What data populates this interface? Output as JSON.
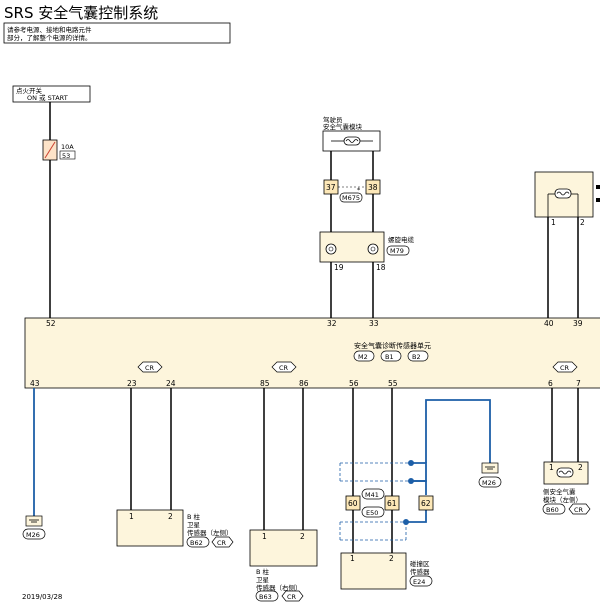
{
  "title": "SRS 安全气囊控制系统",
  "note": {
    "line1": "请参考电源、接地和电路元件",
    "line2": "部分，了解整个电源的详情。"
  },
  "ignition": {
    "line1": "点火开关",
    "line2": "ON 或 START"
  },
  "fuse": {
    "rating": "10A",
    "number": "53"
  },
  "driver_module": {
    "line1": "驾驶员",
    "line2": "安全气囊模块",
    "pin_a": "37",
    "pin_b": "38",
    "connector": "M675",
    "marker": "*"
  },
  "spiral_cable": {
    "label": "螺旋电缆",
    "connector": "M79",
    "pin_a": "19",
    "pin_b": "18"
  },
  "right_module": {
    "pin_a": "1",
    "pin_b": "2"
  },
  "unit": {
    "line1": "安全气囊诊断传感器单元",
    "conn_a": "M2",
    "conn_b": "B1",
    "conn_c": "B2",
    "top_pins": [
      "52",
      "32",
      "33",
      "40",
      "39"
    ],
    "bottom_pins": [
      "43",
      "23",
      "24",
      "85",
      "86",
      "56",
      "55",
      "6",
      "7"
    ],
    "cr_label": "CR"
  },
  "ground_left": "M26",
  "ground_right": "M26",
  "b_pillar_left": {
    "line1": "B 柱",
    "line2": "卫星",
    "line3": "传感器（左侧）",
    "connector": "B62",
    "tag": "CR",
    "pin_a": "1",
    "pin_b": "2"
  },
  "b_pillar_right": {
    "line1": "B 柱",
    "line2": "卫星",
    "line3": "传感器（右侧）",
    "connector": "B63",
    "tag": "CR",
    "pin_a": "1",
    "pin_b": "2"
  },
  "crash_sensor": {
    "line1": "碰撞区",
    "line2": "传感器",
    "connector": "E24",
    "pin_a": "1",
    "pin_b": "2"
  },
  "joint": {
    "pin_a": "60",
    "pin_b": "61",
    "pin_c": "62",
    "conn_a": "M41",
    "conn_b": "E50"
  },
  "side_module": {
    "line1": "侧安全气囊",
    "line2": "模块（左侧）",
    "connector": "B60",
    "tag": "CR",
    "pin_a": "1",
    "pin_b": "2"
  },
  "date": "2019/03/28",
  "colors": {
    "component_fill": "#fdf5dc",
    "wire": "#000000",
    "ground_wire": "#1d5fa8"
  }
}
